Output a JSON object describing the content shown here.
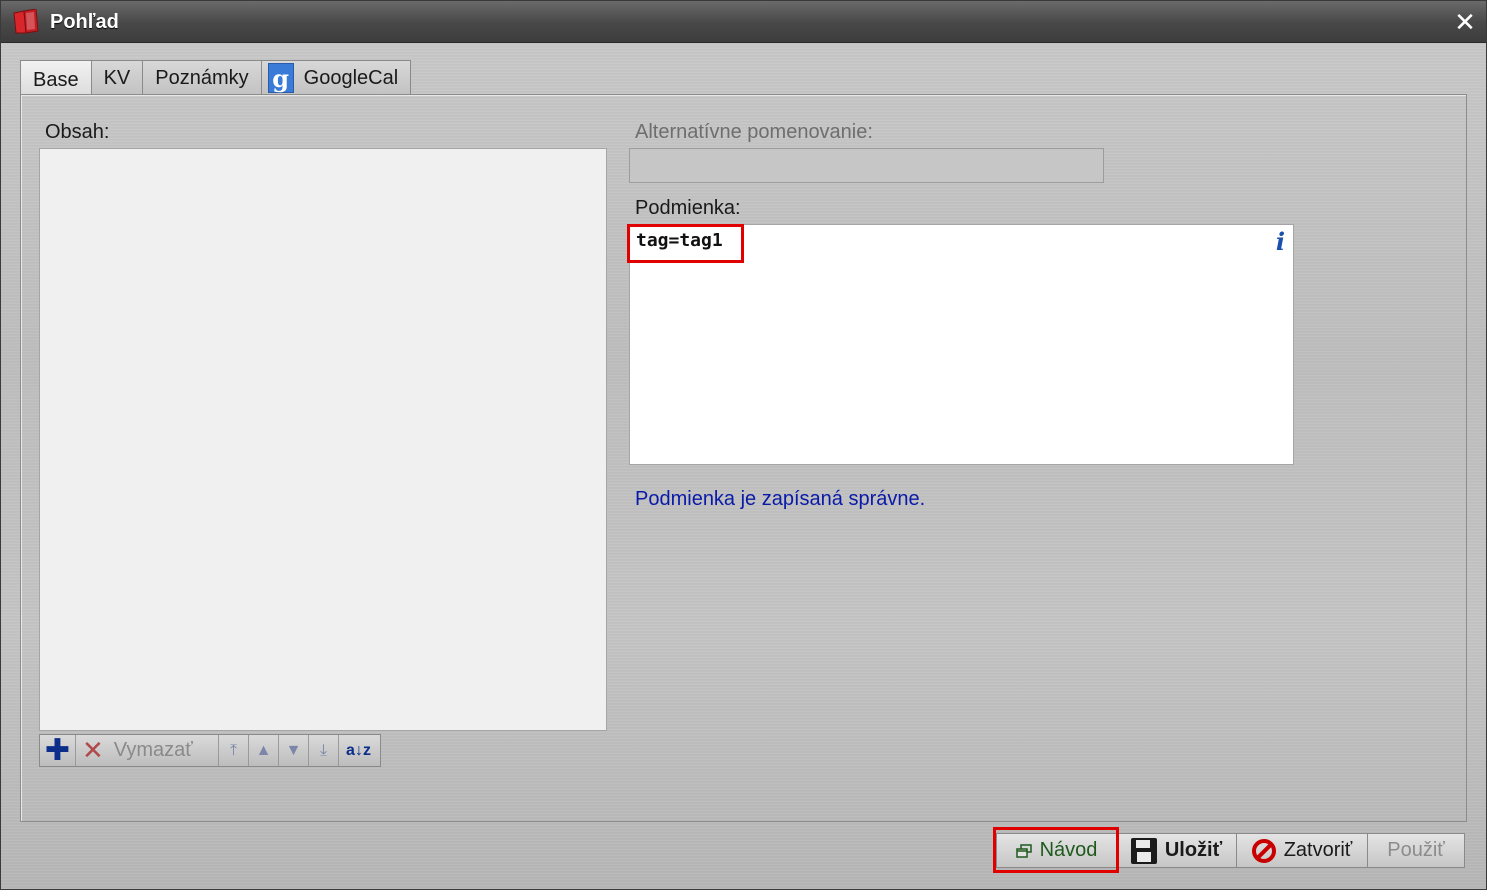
{
  "window": {
    "title": "Pohľad",
    "close_glyph": "✕"
  },
  "tabs": [
    {
      "label": "Base",
      "active": true
    },
    {
      "label": "KV",
      "active": false
    },
    {
      "label": "Poznámky",
      "active": false
    },
    {
      "label": "GoogleCal",
      "active": false,
      "icon": "google-g-icon",
      "icon_glyph": "g"
    }
  ],
  "content": {
    "obsah_label": "Obsah:",
    "items": [],
    "toolbar": {
      "add_glyph": "✚",
      "delete_glyph": "✕",
      "delete_label": "Vymazať",
      "move_top_glyph": "⤒",
      "move_up_glyph": "▲",
      "move_down_glyph": "▼",
      "move_bottom_glyph": "⤓",
      "sort_glyph": "a↓z"
    }
  },
  "alt_name": {
    "label": "Alternatívne pomenovanie:",
    "value": ""
  },
  "condition": {
    "label": "Podmienka:",
    "value": "tag=tag1",
    "info_glyph": "i",
    "status": "Podmienka je zapísaná správne."
  },
  "buttons": {
    "navod": "Návod",
    "ulozit": "Uložiť",
    "zatvorit": "Zatvoriť",
    "pouzit": "Použiť"
  },
  "colors": {
    "status_text": "#0a1aa8",
    "highlight": "#e00000",
    "accent_blue": "#1a4fb0"
  }
}
